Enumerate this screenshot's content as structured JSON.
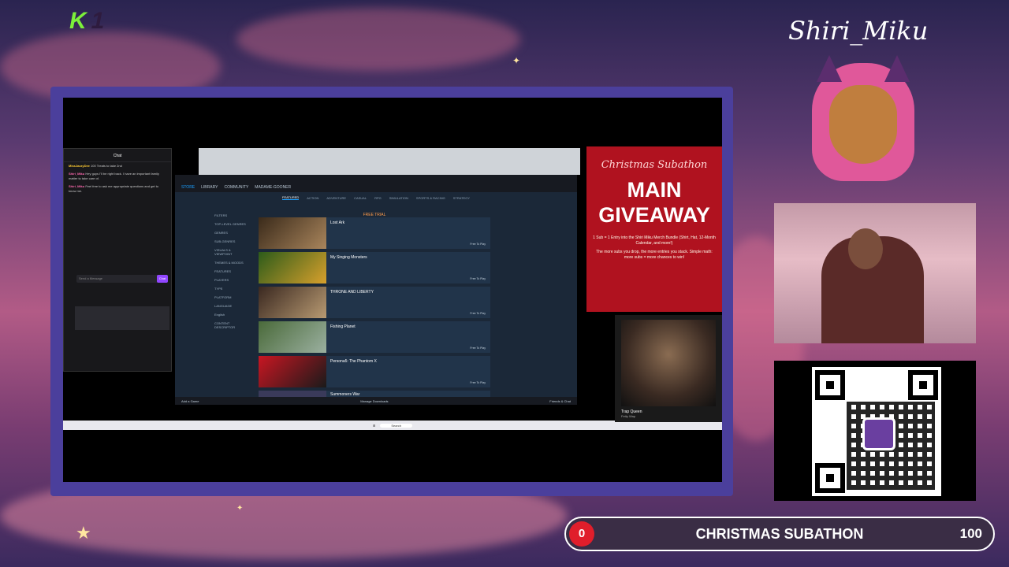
{
  "overlay": {
    "logo_text": "K",
    "logo_number": "1",
    "brand": "Shiri_Miku"
  },
  "chat": {
    "title": "Chat",
    "messages": [
      {
        "user": "MissJazzyDee",
        "text": "100 Treats to take 2nd"
      },
      {
        "user": "Shiri_Miku",
        "text": "Hey guys I'll be right back. I have an important family matter to take care of."
      },
      {
        "user": "Shiri_Miku",
        "text": "Feel free to ask me appropriate questions and get to know me."
      }
    ],
    "input_placeholder": "Send a Message",
    "send_label": "Chat"
  },
  "steam": {
    "nav": [
      "STORE",
      "LIBRARY",
      "COMMUNITY",
      "MADAME-GOONER"
    ],
    "categories": [
      "FEATURED",
      "ACTION",
      "ADVENTURE",
      "CASUAL",
      "RPG",
      "SIMULATION",
      "SPORTS & RACING",
      "STRATEGY"
    ],
    "filters": [
      "FILTERS",
      "TOP-LEVEL GENRES",
      "GENRES",
      "SUB-GENRES",
      "VISUALS & VIEWPOINT",
      "THEMES & MOODS",
      "FEATURES",
      "PLAYERS",
      "TYPE",
      "PLATFORM",
      "LANGUAGE",
      "English",
      "CONTENT DESCRIPTOR"
    ],
    "banner": "FREE TRIAL",
    "games": [
      {
        "title": "Lost Ark",
        "price": "Free To Play"
      },
      {
        "title": "My Singing Monsters",
        "price": "Free To Play"
      },
      {
        "title": "THRONE AND LIBERTY",
        "price": "Free To Play"
      },
      {
        "title": "Fishing Planet",
        "price": "Free To Play"
      },
      {
        "title": "Persona5: The Phantom X",
        "price": "Free To Play"
      },
      {
        "title": "Summoners War",
        "price": ""
      }
    ],
    "footer_left": "Manage Downloads",
    "footer_right": "Friends & Chat",
    "add_game": "Add a Game"
  },
  "taskbar": {
    "search": "Search"
  },
  "poster": {
    "title": "Christmas Subathon",
    "main": "MAIN GIVEAWAY",
    "line1": "1 Sub = 1 Entry into the Shiri Miku Merch Bundle (Shirt, Hat, 12-Month Calendar, and more!)",
    "line2": "The more subs you drop, the more entries you stack. Simple math: more subs = more chances to win!"
  },
  "album": {
    "title": "Trap Queen",
    "artist": "Fetty Wap"
  },
  "subathon": {
    "current": "0",
    "label": "CHRISTMAS SUBATHON",
    "goal": "100"
  }
}
